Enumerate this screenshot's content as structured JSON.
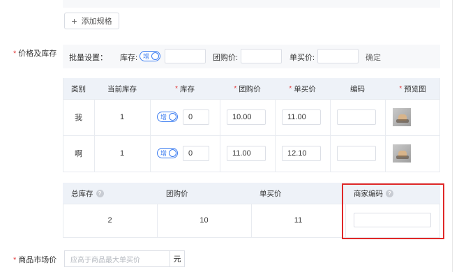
{
  "spec": {
    "add_button_label": "添加规格"
  },
  "price_stock": {
    "label": "价格及库存",
    "batch": {
      "title": "批量设置：",
      "stock_label": "库存:",
      "toggle_label": "增",
      "group_price_label": "团购价:",
      "single_price_label": "单买价:",
      "confirm_label": "确定"
    },
    "columns": [
      "类别",
      "当前库存",
      "库存",
      "团购价",
      "单买价",
      "编码",
      "预览图"
    ],
    "rows": [
      {
        "category": "我",
        "current_stock": "1",
        "toggle": "增",
        "stock": "0",
        "group_price": "10.00",
        "single_price": "11.00",
        "code": ""
      },
      {
        "category": "啊",
        "current_stock": "1",
        "toggle": "增",
        "stock": "0",
        "group_price": "11.00",
        "single_price": "12.10",
        "code": ""
      }
    ],
    "summary": {
      "headers": [
        "总库存",
        "团购价",
        "单买价",
        "商家编码"
      ],
      "total_stock": "2",
      "group_price": "10",
      "single_price": "11",
      "merchant_code": ""
    }
  },
  "market_price": {
    "label": "商品市场价",
    "placeholder": "应高于商品最大单买价",
    "unit": "元"
  },
  "colors": {
    "accent": "#3b7cf0",
    "required": "#e23b3b",
    "highlight_box": "#e02828"
  }
}
